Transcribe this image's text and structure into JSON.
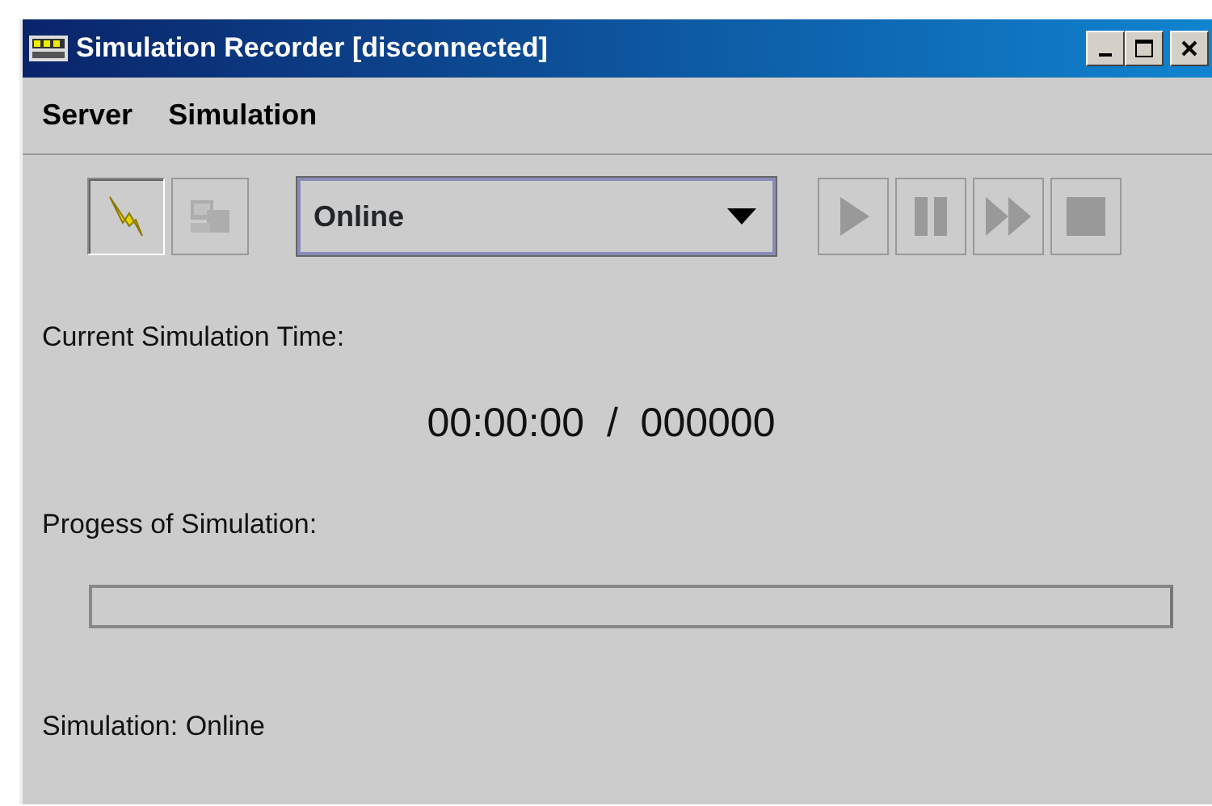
{
  "window": {
    "title": "Simulation Recorder [disconnected]"
  },
  "menu": [
    "Server",
    "Simulation"
  ],
  "toolbar_left": [
    {
      "kind": "connect",
      "disabled": false,
      "selected": true
    },
    {
      "kind": "server",
      "disabled": true,
      "selected": false
    }
  ],
  "mode_select": {
    "value": "Online"
  },
  "playback": [
    {
      "kind": "play",
      "disabled": true
    },
    {
      "kind": "pause",
      "disabled": true
    },
    {
      "kind": "fast-forward",
      "disabled": true
    },
    {
      "kind": "stop",
      "disabled": true
    }
  ],
  "time_label": "Current Simulation Time:",
  "time_value": "00:00:00  /  000000",
  "progress_label": "Progess of Simulation:",
  "progress": {
    "level": 0
  },
  "status": "Simulation: Online"
}
